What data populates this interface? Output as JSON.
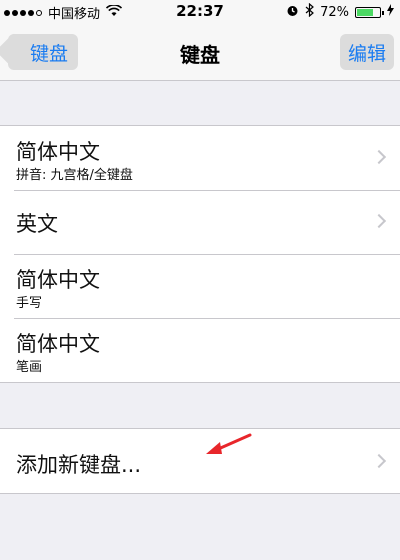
{
  "status_bar": {
    "carrier": "中国移动",
    "time": "22:37",
    "battery_percent": "72%",
    "battery_level": 0.72,
    "signal_bars_filled": 4
  },
  "nav": {
    "back_label": "键盘",
    "title": "键盘",
    "edit_label": "编辑"
  },
  "keyboards": [
    {
      "title": "简体中文",
      "subtitle": "拼音: 九宫格/全键盘"
    },
    {
      "title": "英文"
    },
    {
      "title": "简体中文",
      "subtitle": "手写"
    },
    {
      "title": "简体中文",
      "subtitle": "笔画"
    }
  ],
  "add_keyboard": {
    "label": "添加新键盘..."
  },
  "colors": {
    "accent": "#1a7cf1",
    "background": "#efeff4",
    "annotation_arrow": "#e8262b",
    "battery": "#4cd964"
  },
  "icons": [
    "wifi-icon",
    "alarm-clock-icon",
    "bluetooth-icon",
    "battery-icon",
    "charging-icon",
    "chevron-right-icon"
  ]
}
